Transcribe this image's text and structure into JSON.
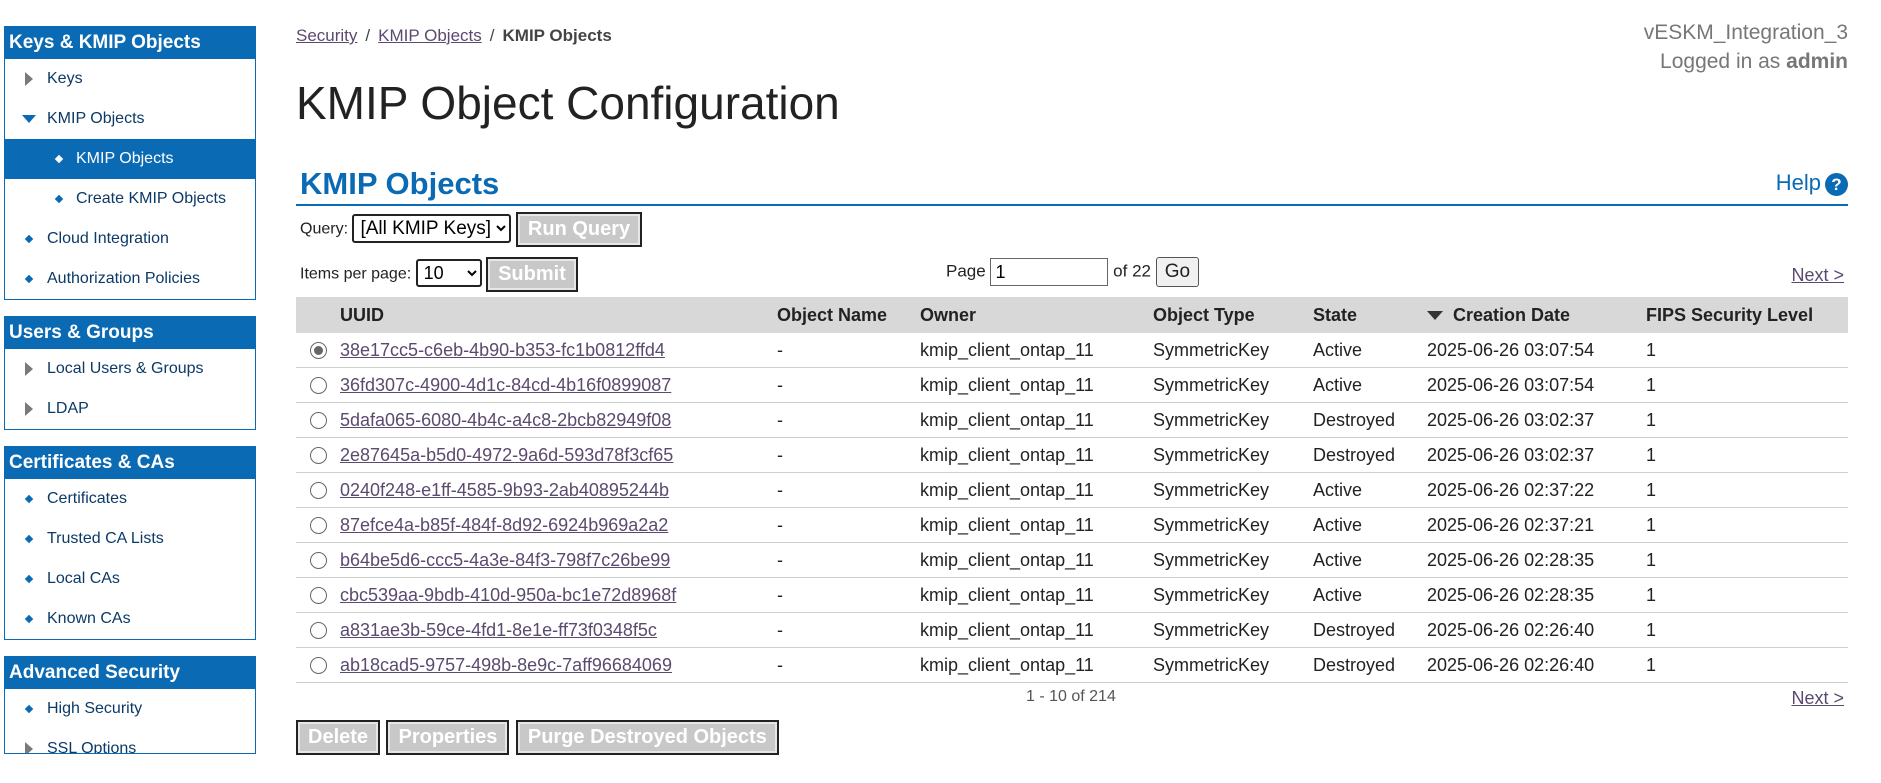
{
  "sidebar": {
    "panels": [
      {
        "title": "Keys & KMIP Objects",
        "items": [
          {
            "label": "Keys"
          },
          {
            "label": "KMIP Objects"
          },
          {
            "label": "KMIP Objects"
          },
          {
            "label": "Create KMIP Objects"
          },
          {
            "label": "Cloud Integration"
          },
          {
            "label": "Authorization Policies"
          }
        ]
      },
      {
        "title": "Users & Groups",
        "items": [
          {
            "label": "Local Users & Groups"
          },
          {
            "label": "LDAP"
          }
        ]
      },
      {
        "title": "Certificates & CAs",
        "items": [
          {
            "label": "Certificates"
          },
          {
            "label": "Trusted CA Lists"
          },
          {
            "label": "Local CAs"
          },
          {
            "label": "Known CAs"
          }
        ]
      },
      {
        "title": "Advanced Security",
        "items": [
          {
            "label": "High Security"
          },
          {
            "label": "SSL Options"
          }
        ]
      }
    ]
  },
  "breadcrumb": {
    "items": [
      "Security",
      "KMIP Objects",
      "KMIP Objects"
    ],
    "separator": "/"
  },
  "header": {
    "host": "vESKM_Integration_3",
    "logged_in_prefix": "Logged in as",
    "user": "admin"
  },
  "page_title": "KMIP Object Configuration",
  "section": {
    "title": "KMIP Objects",
    "help_label": "Help",
    "help_icon": "?"
  },
  "query": {
    "label": "Query:",
    "selected": "[All KMIP Keys]",
    "run_label": "Run Query"
  },
  "paging": {
    "items_per_page_label": "Items per page:",
    "items_per_page": "10",
    "submit_label": "Submit",
    "page_label": "Page",
    "page_value": "1",
    "of_label": "of 22",
    "go_label": "Go",
    "next_label": "Next >",
    "result_count": "1 - 10 of 214"
  },
  "table": {
    "headers": [
      "UUID",
      "Object Name",
      "Owner",
      "Object Type",
      "State",
      "Creation Date",
      "FIPS Security Level"
    ],
    "rows": [
      {
        "uuid": "38e17cc5-c6eb-4b90-b353-fc1b0812ffd4",
        "name": "-",
        "owner": "kmip_client_ontap_11",
        "type": "SymmetricKey",
        "state": "Active",
        "date": "2025-06-26 03:07:54",
        "fips": "1"
      },
      {
        "uuid": "36fd307c-4900-4d1c-84cd-4b16f0899087",
        "name": "-",
        "owner": "kmip_client_ontap_11",
        "type": "SymmetricKey",
        "state": "Active",
        "date": "2025-06-26 03:07:54",
        "fips": "1"
      },
      {
        "uuid": "5dafa065-6080-4b4c-a4c8-2bcb82949f08",
        "name": "-",
        "owner": "kmip_client_ontap_11",
        "type": "SymmetricKey",
        "state": "Destroyed",
        "date": "2025-06-26 03:02:37",
        "fips": "1"
      },
      {
        "uuid": "2e87645a-b5d0-4972-9a6d-593d78f3cf65",
        "name": "-",
        "owner": "kmip_client_ontap_11",
        "type": "SymmetricKey",
        "state": "Destroyed",
        "date": "2025-06-26 03:02:37",
        "fips": "1"
      },
      {
        "uuid": "0240f248-e1ff-4585-9b93-2ab40895244b",
        "name": "-",
        "owner": "kmip_client_ontap_11",
        "type": "SymmetricKey",
        "state": "Active",
        "date": "2025-06-26 02:37:22",
        "fips": "1"
      },
      {
        "uuid": "87efce4a-b85f-484f-8d92-6924b969a2a2",
        "name": "-",
        "owner": "kmip_client_ontap_11",
        "type": "SymmetricKey",
        "state": "Active",
        "date": "2025-06-26 02:37:21",
        "fips": "1"
      },
      {
        "uuid": "b64be5d6-ccc5-4a3e-84f3-798f7c26be99",
        "name": "-",
        "owner": "kmip_client_ontap_11",
        "type": "SymmetricKey",
        "state": "Active",
        "date": "2025-06-26 02:28:35",
        "fips": "1"
      },
      {
        "uuid": "cbc539aa-9bdb-410d-950a-bc1e72d8968f",
        "name": "-",
        "owner": "kmip_client_ontap_11",
        "type": "SymmetricKey",
        "state": "Active",
        "date": "2025-06-26 02:28:35",
        "fips": "1"
      },
      {
        "uuid": "a831ae3b-59ce-4fd1-8e1e-ff73f0348f5c",
        "name": "-",
        "owner": "kmip_client_ontap_11",
        "type": "SymmetricKey",
        "state": "Destroyed",
        "date": "2025-06-26 02:26:40",
        "fips": "1"
      },
      {
        "uuid": "ab18cad5-9757-498b-8e9c-7aff96684069",
        "name": "-",
        "owner": "kmip_client_ontap_11",
        "type": "SymmetricKey",
        "state": "Destroyed",
        "date": "2025-06-26 02:26:40",
        "fips": "1"
      }
    ]
  },
  "actions": {
    "delete_label": "Delete",
    "properties_label": "Properties",
    "purge_label": "Purge Destroyed Objects"
  },
  "colors": {
    "accent": "#0a6ab3",
    "link": "#5b4a6e",
    "disabled_button": "#c8c8c8"
  }
}
